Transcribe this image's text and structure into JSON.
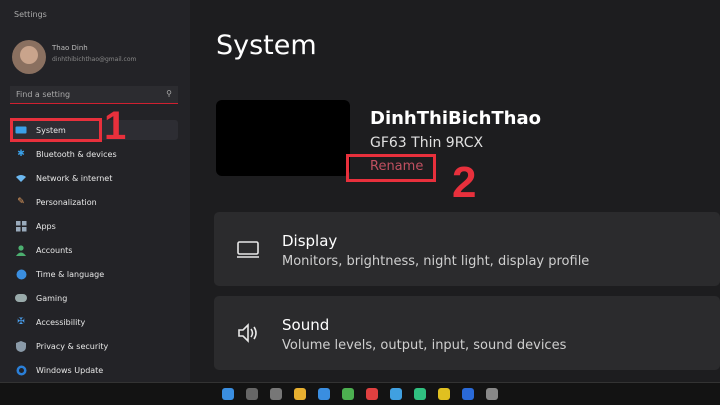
{
  "window": {
    "title": "Settings"
  },
  "user": {
    "name": "Thao Dinh",
    "email": "dinhthibichthao@gmail.com"
  },
  "search": {
    "placeholder": "Find a setting"
  },
  "sidebar": {
    "items": [
      {
        "label": "System",
        "icon": "monitor-icon"
      },
      {
        "label": "Bluetooth & devices",
        "icon": "bluetooth-icon"
      },
      {
        "label": "Network & internet",
        "icon": "wifi-icon"
      },
      {
        "label": "Personalization",
        "icon": "brush-icon"
      },
      {
        "label": "Apps",
        "icon": "apps-icon"
      },
      {
        "label": "Accounts",
        "icon": "person-icon"
      },
      {
        "label": "Time & language",
        "icon": "globe-clock-icon"
      },
      {
        "label": "Gaming",
        "icon": "gamepad-icon"
      },
      {
        "label": "Accessibility",
        "icon": "accessibility-icon"
      },
      {
        "label": "Privacy & security",
        "icon": "shield-icon"
      },
      {
        "label": "Windows Update",
        "icon": "update-icon"
      }
    ]
  },
  "annotations": {
    "marker1": "1",
    "marker2": "2",
    "color": "#e8303c"
  },
  "main": {
    "title": "System",
    "device": {
      "name": "DinhThiBichThao",
      "model": "GF63 Thin 9RCX",
      "rename": "Rename"
    },
    "cards": [
      {
        "title": "Display",
        "subtitle": "Monitors, brightness, night light, display profile",
        "icon": "display-icon"
      },
      {
        "title": "Sound",
        "subtitle": "Volume levels, output, input, sound devices",
        "icon": "speaker-icon"
      }
    ]
  },
  "taskbar": {
    "tray": ""
  }
}
